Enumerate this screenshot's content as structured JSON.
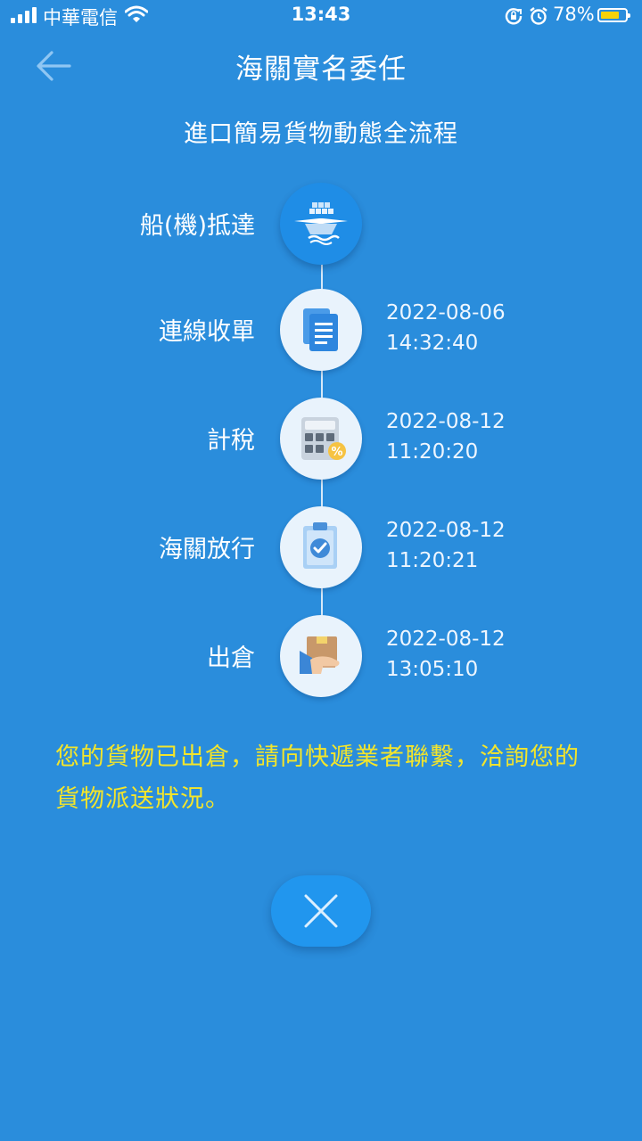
{
  "status_bar": {
    "carrier": "中華電信",
    "time": "13:43",
    "battery": "78%",
    "battery_level": 0.78,
    "icons": [
      "signal-icon",
      "wifi-icon",
      "rotation-lock-icon",
      "alarm-icon",
      "battery-icon"
    ]
  },
  "header": {
    "back_icon": "arrow-left-icon",
    "title": "海關實名委任"
  },
  "subtitle": "進口簡易貨物動態全流程",
  "steps": [
    {
      "label": "船(機)抵達",
      "date": "",
      "time": "",
      "icon": "ship-plane-icon",
      "active": true
    },
    {
      "label": "連線收單",
      "date": "2022-08-06",
      "time": "14:32:40",
      "icon": "document-icon",
      "active": false
    },
    {
      "label": "計稅",
      "date": "2022-08-12",
      "time": "11:20:20",
      "icon": "calculator-icon",
      "active": false
    },
    {
      "label": "海關放行",
      "date": "2022-08-12",
      "time": "11:20:21",
      "icon": "clipboard-check-icon",
      "active": false
    },
    {
      "label": "出倉",
      "date": "2022-08-12",
      "time": "13:05:10",
      "icon": "package-hand-icon",
      "active": false
    }
  ],
  "message": "您的貨物已出倉，請向快遞業者聯繫，洽詢您的貨物派送狀況。",
  "close_icon": "close-icon",
  "colors": {
    "background": "#2a8ddc",
    "message": "#f3e52b",
    "battery": "#f5d20a",
    "active_step": "#1f8de6",
    "step_circle": "#e9f3fc"
  }
}
